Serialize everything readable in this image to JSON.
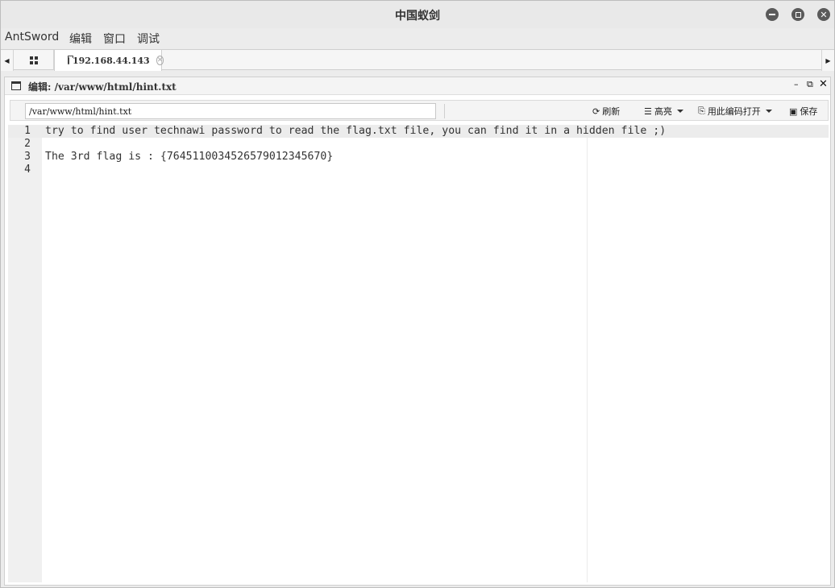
{
  "window": {
    "title": "中国蚁剑"
  },
  "menu": {
    "items": [
      "AntSword",
      "编辑",
      "窗口",
      "调试"
    ]
  },
  "tabs": {
    "active_label": "192.168.44.143"
  },
  "panel": {
    "title": "编辑: /var/www/html/hint.txt"
  },
  "toolbar": {
    "path_value": "/var/www/html/hint.txt",
    "refresh_label": "刷新",
    "highlight_label": "高亮",
    "open_with_encoding_label": "用此编码打开",
    "save_label": "保存"
  },
  "editor": {
    "lines": [
      {
        "number": "1",
        "text": "try to find user technawi password to read the flag.txt file, you can find it in a hidden file ;)"
      },
      {
        "number": "2",
        "text": ""
      },
      {
        "number": "3",
        "text": "The 3rd flag is : {7645110034526579012345670}"
      },
      {
        "number": "4",
        "text": ""
      }
    ]
  }
}
